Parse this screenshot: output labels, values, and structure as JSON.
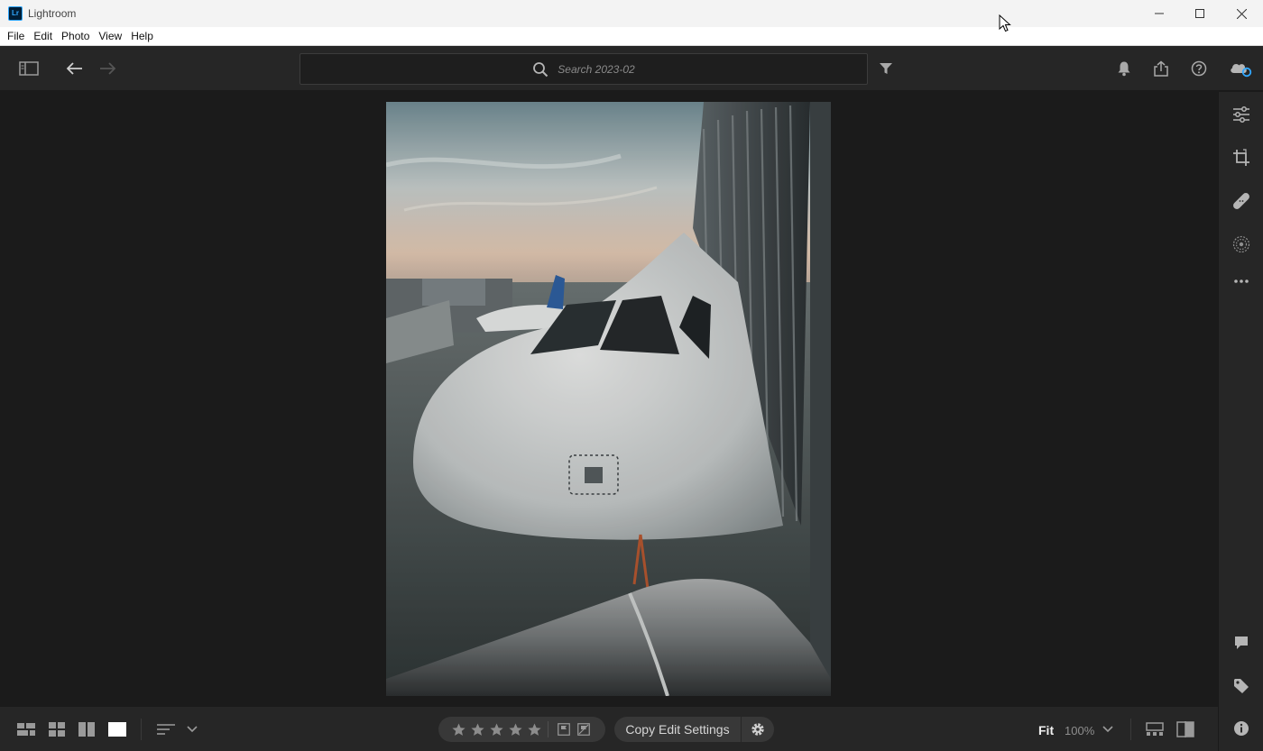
{
  "window": {
    "title": "Lightroom",
    "logo_text": "Lr"
  },
  "menu": {
    "items": [
      "File",
      "Edit",
      "Photo",
      "View",
      "Help"
    ]
  },
  "toolbar": {
    "search_placeholder": "Search 2023-02"
  },
  "photo": {
    "subject": "airplane-nose-at-jet-bridge"
  },
  "right_panel": {
    "top_tools": [
      "edit-sliders-icon",
      "crop-icon",
      "healing-icon",
      "masking-icon",
      "more-icon"
    ],
    "bottom_tools": [
      "comment-icon",
      "tag-icon",
      "info-icon"
    ]
  },
  "bottombar": {
    "rating_stars": 5,
    "copy_label": "Copy Edit Settings",
    "fit_label": "Fit",
    "zoom_label": "100%"
  },
  "colors": {
    "accent": "#31a8ff",
    "panel": "#262626",
    "stage": "#1b1b1b"
  }
}
